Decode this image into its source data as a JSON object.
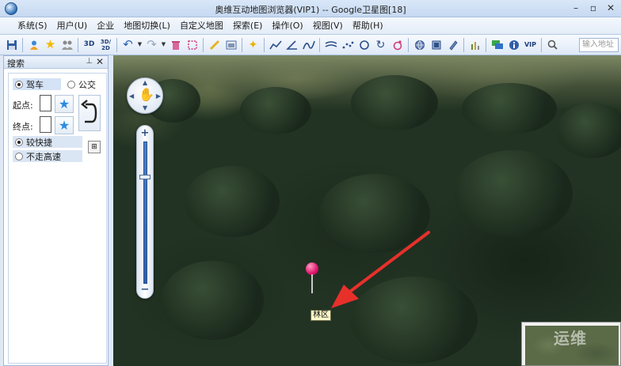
{
  "window": {
    "title": "奥维互动地图浏览器(VIP1) -- Google卫星图[18]",
    "minimize_glyph": "–",
    "restore_glyph": "▫",
    "close_glyph": "✕"
  },
  "menu": {
    "items": [
      "系统(S)",
      "用户(U)",
      "企业",
      "地图切换(L)",
      "自定义地图",
      "探索(E)",
      "操作(O)",
      "视图(V)",
      "帮助(H)"
    ]
  },
  "toolbar": {
    "btn_3d": "3D",
    "btn_3d2d": "3D/2D",
    "btn_vip": "VIP",
    "search_placeholder": "输入地址",
    "icons": [
      "save-icon",
      "user-icon",
      "favorite-star-icon",
      "group-icon",
      "undo-icon",
      "redo-icon",
      "delete-icon",
      "select-icon",
      "ruler-icon",
      "image-icon",
      "star-tool-icon",
      "polyline-icon",
      "angle-icon",
      "curve-icon",
      "track-icon",
      "points-icon",
      "circle-icon",
      "rotate-icon",
      "marker-icon",
      "globe-icon",
      "layer-icon",
      "edit-icon",
      "report-icon",
      "chat-icon",
      "info-icon",
      "search-icon"
    ]
  },
  "search_panel": {
    "title": "搜索",
    "pin_glyph": "⊥",
    "close_glyph": "✕",
    "mode_drive": "驾车",
    "mode_transit": "公交",
    "start_label": "起点:",
    "end_label": "终点:",
    "option_fast": "较快捷",
    "option_no_highway": "不走高速",
    "calc_glyph": "⊞"
  },
  "map": {
    "label": "林区",
    "overview_watermark": "运维"
  }
}
